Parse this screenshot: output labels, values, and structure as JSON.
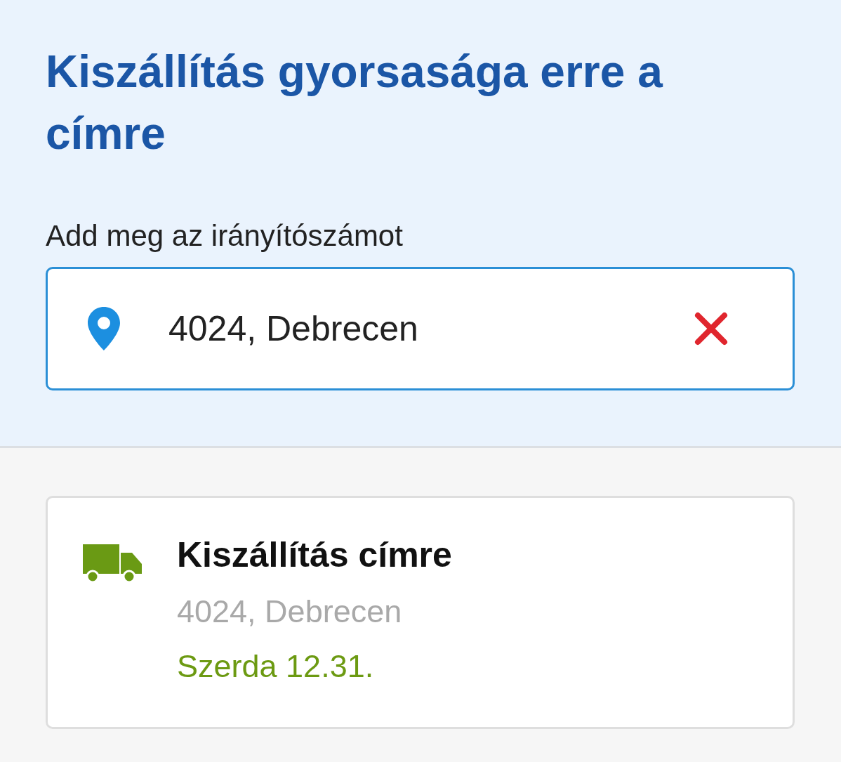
{
  "header": {
    "title": "Kiszállítás gyorsasága erre a címre",
    "label": "Add meg az irányítószámot",
    "field": {
      "value": "4024, Debrecen"
    }
  },
  "option": {
    "title": "Kiszállítás címre",
    "address": "4024, Debrecen",
    "date": "Szerda 12.31."
  }
}
